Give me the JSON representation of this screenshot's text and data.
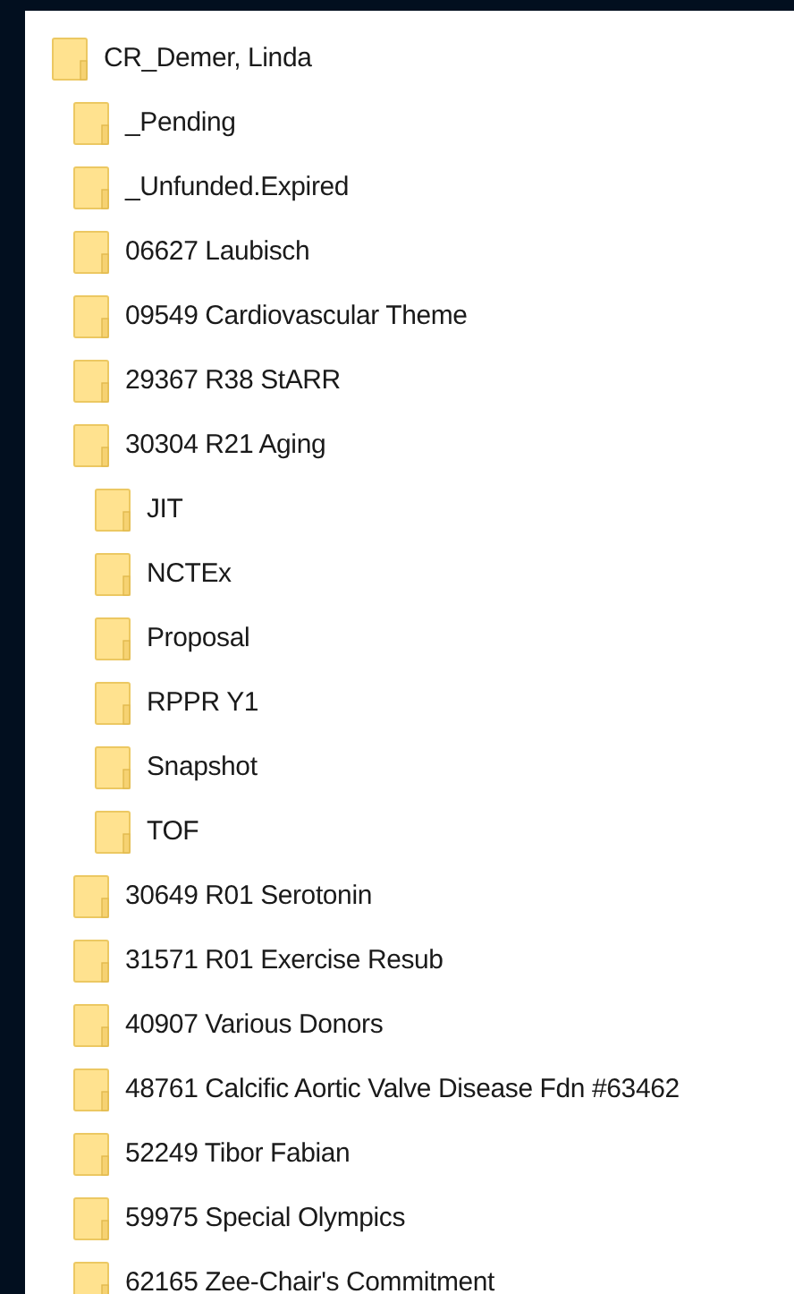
{
  "tree": [
    {
      "label": "CR_Demer, Linda",
      "children": [
        {
          "label": "_Pending"
        },
        {
          "label": "_Unfunded.Expired"
        },
        {
          "label": "06627 Laubisch"
        },
        {
          "label": "09549 Cardiovascular Theme"
        },
        {
          "label": "29367 R38 StARR"
        },
        {
          "label": "30304 R21 Aging",
          "children": [
            {
              "label": "JIT"
            },
            {
              "label": "NCTEx"
            },
            {
              "label": "Proposal"
            },
            {
              "label": "RPPR Y1"
            },
            {
              "label": "Snapshot"
            },
            {
              "label": "TOF"
            }
          ]
        },
        {
          "label": "30649 R01 Serotonin"
        },
        {
          "label": "31571 R01 Exercise Resub"
        },
        {
          "label": "40907 Various Donors"
        },
        {
          "label": "48761 Calcific Aortic Valve Disease Fdn #63462"
        },
        {
          "label": "52249 Tibor Fabian"
        },
        {
          "label": "59975 Special Olympics"
        },
        {
          "label": "62165 Zee-Chair's Commitment"
        }
      ]
    }
  ]
}
